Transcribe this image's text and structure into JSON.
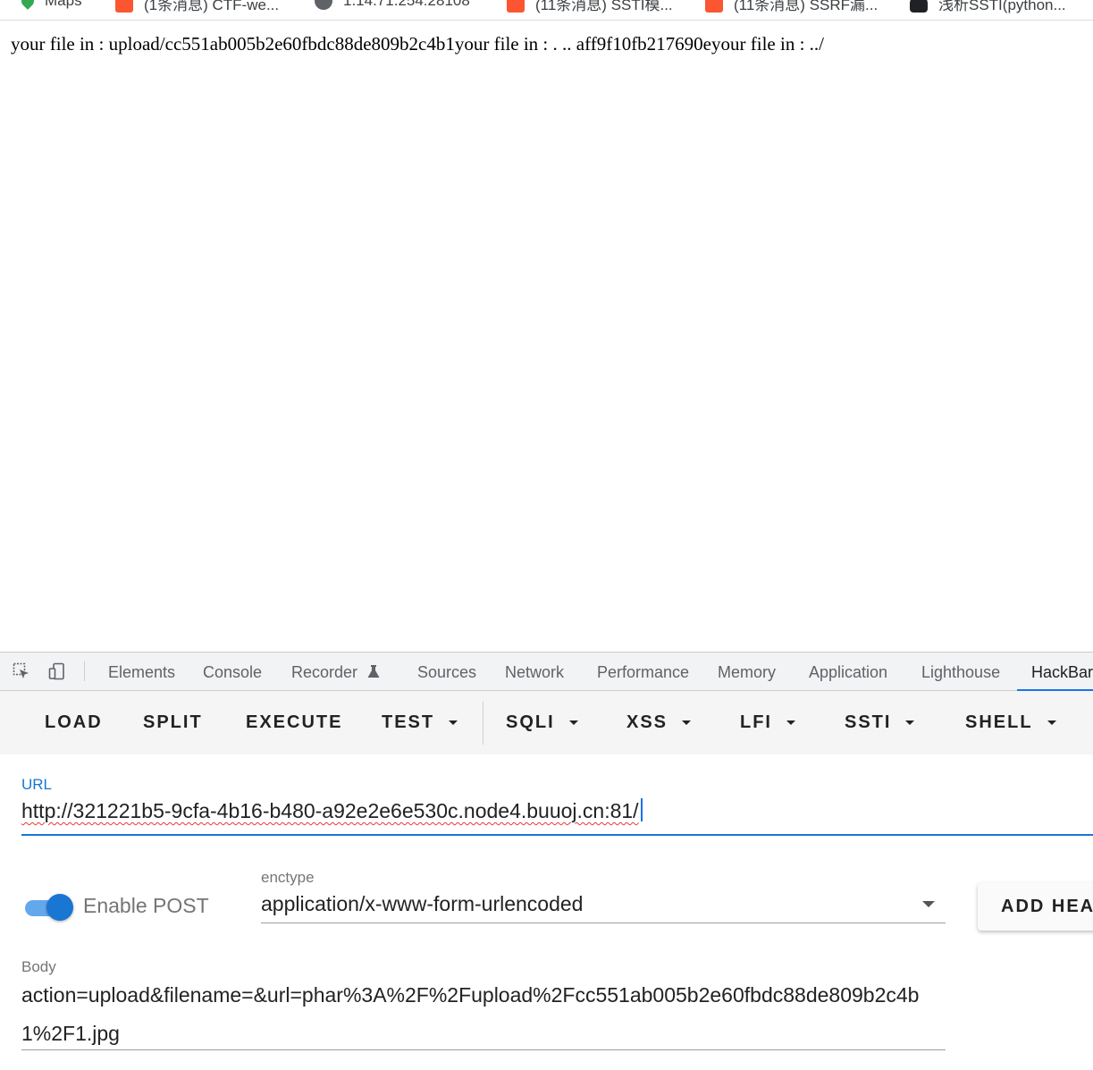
{
  "bookmarks": [
    {
      "label": "Maps",
      "icon": "maps-icon"
    },
    {
      "label": "(1条消息) CTF-we...",
      "icon": "csdn-icon"
    },
    {
      "label": "1.14.71.254:28108",
      "icon": "globe-icon"
    },
    {
      "label": "(11条消息) SSTI模...",
      "icon": "csdn-icon"
    },
    {
      "label": "(11条消息) SSRF漏...",
      "icon": "csdn-icon"
    },
    {
      "label": "浅析SSTI(python...",
      "icon": "spade-icon"
    }
  ],
  "page": {
    "text": "your file in : upload/cc551ab005b2e60fbdc88de809b2c4b1your file in : . .. aff9f10fb217690eyour file in : ../"
  },
  "devtools": {
    "tabs": [
      "Elements",
      "Console",
      "Recorder",
      "Sources",
      "Network",
      "Performance",
      "Memory",
      "Application",
      "Lighthouse",
      "HackBar"
    ],
    "active_tab": "HackBar"
  },
  "hackbar": {
    "buttons": {
      "load": "LOAD",
      "split": "SPLIT",
      "execute": "EXECUTE",
      "test": "TEST",
      "sqli": "SQLI",
      "xss": "XSS",
      "lfi": "LFI",
      "ssti": "SSTI",
      "shell": "SHELL"
    },
    "url_label": "URL",
    "url_value": "http://321221b5-9cfa-4b16-b480-a92e2e6e530c.node4.buuoj.cn:81/",
    "enable_post_label": "Enable POST",
    "enable_post": true,
    "enctype_label": "enctype",
    "enctype_value": "application/x-www-form-urlencoded",
    "add_header_label": "ADD HEADER",
    "body_label": "Body",
    "body_value": "action=upload&filename=&url=phar%3A%2F%2Fupload%2Fcc551ab005b2e60fbdc88de809b2c4b1%2F1.jpg"
  },
  "colors": {
    "accent": "#1976d2",
    "tab_active_underline": "#1a73e8",
    "csdn": "#fc5531"
  }
}
